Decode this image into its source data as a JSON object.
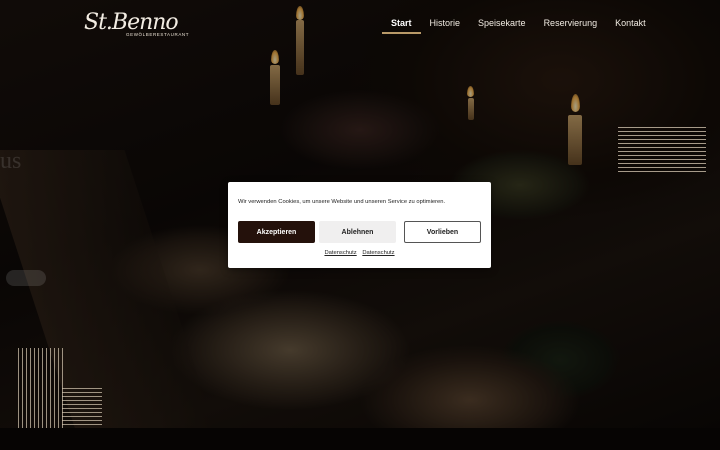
{
  "header": {
    "logo_script": "St.Benno",
    "logo_subtitle": "GEWÖLBERESTAURANT"
  },
  "nav": {
    "items": [
      {
        "label": "Start",
        "active": true
      },
      {
        "label": "Historie",
        "active": false
      },
      {
        "label": "Speisekarte",
        "active": false
      },
      {
        "label": "Reservierung",
        "active": false
      },
      {
        "label": "Kontakt",
        "active": false
      }
    ]
  },
  "cookie_banner": {
    "message": "Wir verwenden Cookies, um unsere Website und unseren Service zu optimieren.",
    "accept_label": "Akzeptieren",
    "decline_label": "Ablehnen",
    "preferences_label": "Vorlieben",
    "links": [
      "Datenschutz",
      "Datenschutz"
    ]
  },
  "colors": {
    "accent": "#b89968",
    "accept_button": "#24110b",
    "nav_text": "#f1ebe2"
  }
}
